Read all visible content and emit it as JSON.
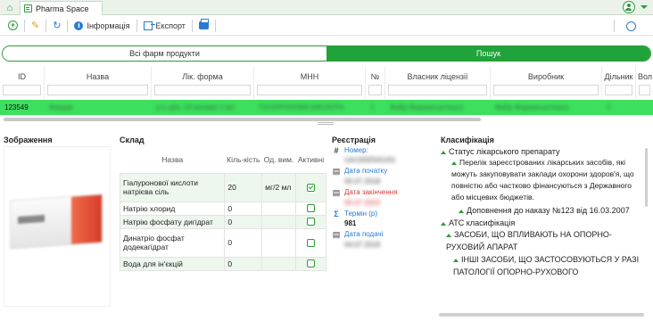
{
  "app": {
    "tab_title": "Pharma Space"
  },
  "toolbar": {
    "info_label": "Інформація",
    "export_label": "Експорт"
  },
  "tabs": [
    {
      "label": "Всі фарм продукти",
      "active": false
    },
    {
      "label": "Пошук",
      "active": true
    }
  ],
  "grid": {
    "columns": [
      "ID",
      "Назва",
      "Лік. форма",
      "МНН",
      "№",
      "Власник ліцензії",
      "Виробник",
      "Дільник",
      "Вол"
    ],
    "selected_row": {
      "id": "123549",
      "name": "Ферідж",
      "form": "р-н д/ін. 10 мл/амп 2 мл",
      "inn": "ГІАЛУРОНОВА КИСЛОТА",
      "num": "1",
      "owner": "Фабр Фармасьютікалз",
      "maker": "Фабр Фармасьютікалз",
      "div": "1"
    }
  },
  "sections": {
    "image": "Зображення",
    "composition": "Склад",
    "registration": "Реєстрація",
    "classification": "Класифікація"
  },
  "composition": {
    "headers": {
      "name": "Назва",
      "qty": "Кіль-кість",
      "unit": "Од. вим.",
      "active": "Активні"
    },
    "rows": [
      {
        "name": "Гіалуронової кислоти натрієва сіль",
        "qty": "20",
        "unit": "мг/2 мл",
        "active": true
      },
      {
        "name": "Натрію хлорид",
        "qty": "0",
        "unit": "",
        "active": false
      },
      {
        "name": "Натрію фосфату дигідрат",
        "qty": "0",
        "unit": "",
        "active": false
      },
      {
        "name": "Динатріо фосфат додекагідрат",
        "qty": "0",
        "unit": "",
        "active": false
      },
      {
        "name": "Вода для ін'єкцій",
        "qty": "0",
        "unit": "",
        "active": false
      }
    ]
  },
  "registration": {
    "number_label": "Номер:",
    "number_value": "UA/19325/01/01",
    "start_label": "Дата початку",
    "start_value": "05.07.2018",
    "end_label": "Дата закінчення",
    "end_value": "05.07.2023",
    "term_label": "Термін (р)",
    "term_value": "981",
    "submit_label": "Дата подачі",
    "submit_value": "04.07.2018"
  },
  "classification": {
    "status_title": "Статус лікарського препарату",
    "status_text": "Перелік зареєстрованих лікарських засобів, які можуть закуповувати заклади охорони здоров'я, що повністю або частково фінансуються з Державного або місцевих бюджетів.",
    "addition": "Доповнення до наказу №123 від 16.03.2007",
    "atc_title": "АТС класифікація",
    "atc_1": "ЗАСОБИ, ЩО ВПЛИВАЮТЬ НА ОПОРНО-РУХОВИЙ АПАРАТ",
    "atc_2": "ІНШІ ЗАСОБИ, ЩО ЗАСТОСОВУЮТЬСЯ У РАЗІ ПАТОЛОГІЇ ОПОРНО-РУХОВОГО"
  },
  "colors": {
    "accent": "#1fa33a",
    "selection": "#3de05e",
    "link": "#2a7bd0",
    "danger": "#d43c3c"
  },
  "icons": [
    "home-icon",
    "app-tab-icon",
    "user-icon",
    "chevron-down-icon",
    "add-icon",
    "edit-icon",
    "refresh-icon",
    "info-icon",
    "export-icon",
    "print-icon",
    "globe-icon"
  ]
}
